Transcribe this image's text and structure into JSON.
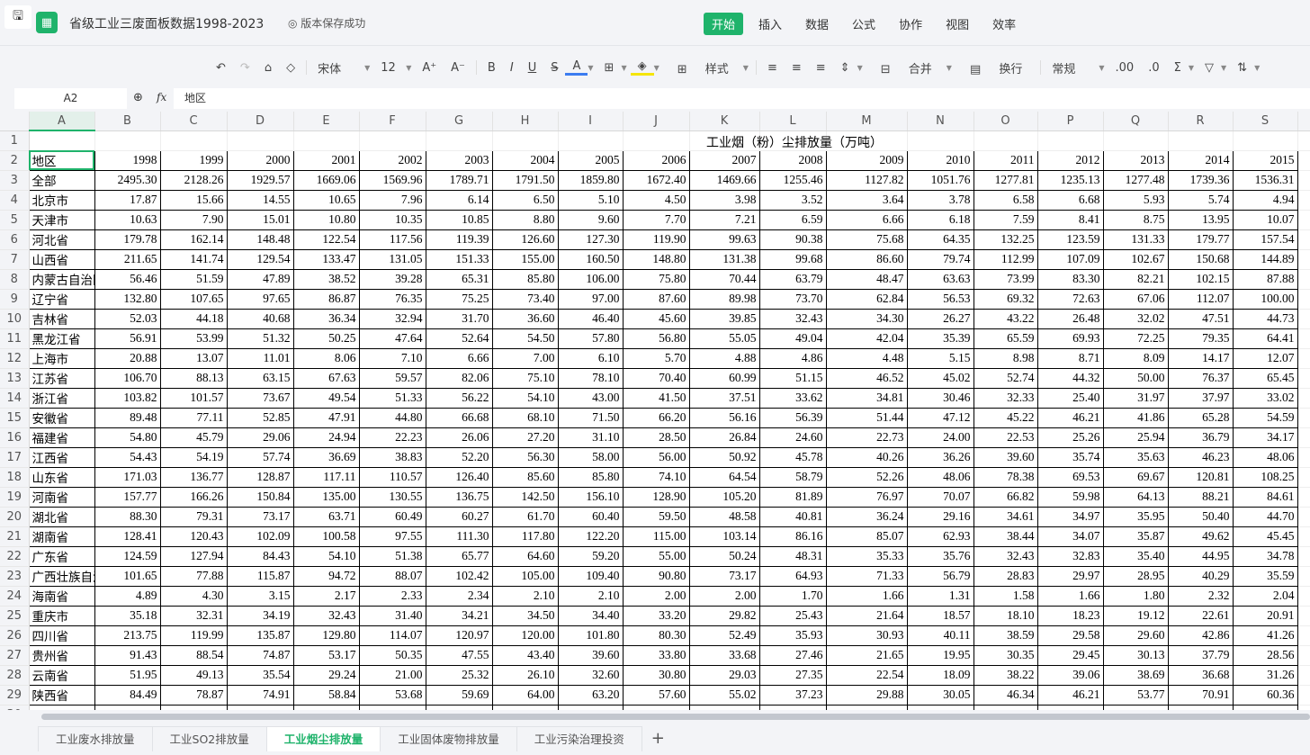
{
  "app": {
    "title": "省级工业三废面板数据1998-2023",
    "save_status": "版本保存成功"
  },
  "menu": [
    "开始",
    "插入",
    "数据",
    "公式",
    "协作",
    "视图",
    "效率"
  ],
  "toolbar": {
    "font": "宋体",
    "font_size": "12",
    "style_label": "样式",
    "merge_label": "合并",
    "wrap_label": "换行",
    "number_format": "常规"
  },
  "formula_bar": {
    "cell_ref": "A2",
    "fx": "fx",
    "value": "地区"
  },
  "columns": [
    "A",
    "B",
    "C",
    "D",
    "E",
    "F",
    "G",
    "H",
    "I",
    "J",
    "K",
    "L",
    "M",
    "N",
    "O",
    "P",
    "Q",
    "R",
    "S"
  ],
  "sheet": {
    "title": "工业烟（粉）尘排放量（万吨）",
    "header": [
      "地区",
      "1998",
      "1999",
      "2000",
      "2001",
      "2002",
      "2003",
      "2004",
      "2005",
      "2006",
      "2007",
      "2008",
      "2009",
      "2010",
      "2011",
      "2012",
      "2013",
      "2014",
      "2015"
    ],
    "rows": [
      [
        "全部",
        "2495.30",
        "2128.26",
        "1929.57",
        "1669.06",
        "1569.96",
        "1789.71",
        "1791.50",
        "1859.80",
        "1672.40",
        "1469.66",
        "1255.46",
        "1127.82",
        "1051.76",
        "1277.81",
        "1235.13",
        "1277.48",
        "1739.36",
        "1536.31"
      ],
      [
        "北京市",
        "17.87",
        "15.66",
        "14.55",
        "10.65",
        "7.96",
        "6.14",
        "6.50",
        "5.10",
        "4.50",
        "3.98",
        "3.52",
        "3.64",
        "3.78",
        "6.58",
        "6.68",
        "5.93",
        "5.74",
        "4.94"
      ],
      [
        "天津市",
        "10.63",
        "7.90",
        "15.01",
        "10.80",
        "10.35",
        "10.85",
        "8.80",
        "9.60",
        "7.70",
        "7.21",
        "6.59",
        "6.66",
        "6.18",
        "7.59",
        "8.41",
        "8.75",
        "13.95",
        "10.07"
      ],
      [
        "河北省",
        "179.78",
        "162.14",
        "148.48",
        "122.54",
        "117.56",
        "119.39",
        "126.60",
        "127.30",
        "119.90",
        "99.63",
        "90.38",
        "75.68",
        "64.35",
        "132.25",
        "123.59",
        "131.33",
        "179.77",
        "157.54"
      ],
      [
        "山西省",
        "211.65",
        "141.74",
        "129.54",
        "133.47",
        "131.05",
        "151.33",
        "155.00",
        "160.50",
        "148.80",
        "131.38",
        "99.68",
        "86.60",
        "79.74",
        "112.99",
        "107.09",
        "102.67",
        "150.68",
        "144.89"
      ],
      [
        "内蒙古自治区",
        "56.46",
        "51.59",
        "47.89",
        "38.52",
        "39.28",
        "65.31",
        "85.80",
        "106.00",
        "75.80",
        "70.44",
        "63.79",
        "48.47",
        "63.63",
        "73.99",
        "83.30",
        "82.21",
        "102.15",
        "87.88"
      ],
      [
        "辽宁省",
        "132.80",
        "107.65",
        "97.65",
        "86.87",
        "76.35",
        "75.25",
        "73.40",
        "97.00",
        "87.60",
        "89.98",
        "73.70",
        "62.84",
        "56.53",
        "69.32",
        "72.63",
        "67.06",
        "112.07",
        "100.00"
      ],
      [
        "吉林省",
        "52.03",
        "44.18",
        "40.68",
        "36.34",
        "32.94",
        "31.70",
        "36.60",
        "46.40",
        "45.60",
        "39.85",
        "32.43",
        "34.30",
        "26.27",
        "43.22",
        "26.48",
        "32.02",
        "47.51",
        "44.73"
      ],
      [
        "黑龙江省",
        "56.91",
        "53.99",
        "51.32",
        "50.25",
        "47.64",
        "52.64",
        "54.50",
        "57.80",
        "56.80",
        "55.05",
        "49.04",
        "42.04",
        "35.39",
        "65.59",
        "69.93",
        "72.25",
        "79.35",
        "64.41"
      ],
      [
        "上海市",
        "20.88",
        "13.07",
        "11.01",
        "8.06",
        "7.10",
        "6.66",
        "7.00",
        "6.10",
        "5.70",
        "4.88",
        "4.86",
        "4.48",
        "5.15",
        "8.98",
        "8.71",
        "8.09",
        "14.17",
        "12.07"
      ],
      [
        "江苏省",
        "106.70",
        "88.13",
        "63.15",
        "67.63",
        "59.57",
        "82.06",
        "75.10",
        "78.10",
        "70.40",
        "60.99",
        "51.15",
        "46.52",
        "45.02",
        "52.74",
        "44.32",
        "50.00",
        "76.37",
        "65.45"
      ],
      [
        "浙江省",
        "103.82",
        "101.57",
        "73.67",
        "49.54",
        "51.33",
        "56.22",
        "54.10",
        "43.00",
        "41.50",
        "37.51",
        "33.62",
        "34.81",
        "30.46",
        "32.33",
        "25.40",
        "31.97",
        "37.97",
        "33.02"
      ],
      [
        "安徽省",
        "89.48",
        "77.11",
        "52.85",
        "47.91",
        "44.80",
        "66.68",
        "68.10",
        "71.50",
        "66.20",
        "56.16",
        "56.39",
        "51.44",
        "47.12",
        "45.22",
        "46.21",
        "41.86",
        "65.28",
        "54.59"
      ],
      [
        "福建省",
        "54.80",
        "45.79",
        "29.06",
        "24.94",
        "22.23",
        "26.06",
        "27.20",
        "31.10",
        "28.50",
        "26.84",
        "24.60",
        "22.73",
        "24.00",
        "22.53",
        "25.26",
        "25.94",
        "36.79",
        "34.17"
      ],
      [
        "江西省",
        "54.43",
        "54.19",
        "57.74",
        "36.69",
        "38.83",
        "52.20",
        "56.30",
        "58.00",
        "56.00",
        "50.92",
        "45.78",
        "40.26",
        "36.26",
        "39.60",
        "35.74",
        "35.63",
        "46.23",
        "48.06"
      ],
      [
        "山东省",
        "171.03",
        "136.77",
        "128.87",
        "117.11",
        "110.57",
        "126.40",
        "85.60",
        "85.80",
        "74.10",
        "64.54",
        "58.79",
        "52.26",
        "48.06",
        "78.38",
        "69.53",
        "69.67",
        "120.81",
        "108.25"
      ],
      [
        "河南省",
        "157.77",
        "166.26",
        "150.84",
        "135.00",
        "130.55",
        "136.75",
        "142.50",
        "156.10",
        "128.90",
        "105.20",
        "81.89",
        "76.97",
        "70.07",
        "66.82",
        "59.98",
        "64.13",
        "88.21",
        "84.61"
      ],
      [
        "湖北省",
        "88.30",
        "79.31",
        "73.17",
        "63.71",
        "60.49",
        "60.27",
        "61.70",
        "60.40",
        "59.50",
        "48.58",
        "40.81",
        "36.24",
        "29.16",
        "34.61",
        "34.97",
        "35.95",
        "50.40",
        "44.70"
      ],
      [
        "湖南省",
        "128.41",
        "120.43",
        "102.09",
        "100.58",
        "97.55",
        "111.30",
        "117.80",
        "122.20",
        "115.00",
        "103.14",
        "86.16",
        "85.07",
        "62.93",
        "38.44",
        "34.07",
        "35.87",
        "49.62",
        "45.45"
      ],
      [
        "广东省",
        "124.59",
        "127.94",
        "84.43",
        "54.10",
        "51.38",
        "65.77",
        "64.60",
        "59.20",
        "55.00",
        "50.24",
        "48.31",
        "35.33",
        "35.76",
        "32.43",
        "32.83",
        "35.40",
        "44.95",
        "34.78"
      ],
      [
        "广西壮族自治区",
        "101.65",
        "77.88",
        "115.87",
        "94.72",
        "88.07",
        "102.42",
        "105.00",
        "109.40",
        "90.80",
        "73.17",
        "64.93",
        "71.33",
        "56.79",
        "28.83",
        "29.97",
        "28.95",
        "40.29",
        "35.59"
      ],
      [
        "海南省",
        "4.89",
        "4.30",
        "3.15",
        "2.17",
        "2.33",
        "2.34",
        "2.10",
        "2.10",
        "2.00",
        "2.00",
        "1.70",
        "1.66",
        "1.31",
        "1.58",
        "1.66",
        "1.80",
        "2.32",
        "2.04"
      ],
      [
        "重庆市",
        "35.18",
        "32.31",
        "34.19",
        "32.43",
        "31.40",
        "34.21",
        "34.50",
        "34.40",
        "33.20",
        "29.82",
        "25.43",
        "21.64",
        "18.57",
        "18.10",
        "18.23",
        "19.12",
        "22.61",
        "20.91"
      ],
      [
        "四川省",
        "213.75",
        "119.99",
        "135.87",
        "129.80",
        "114.07",
        "120.97",
        "120.00",
        "101.80",
        "80.30",
        "52.49",
        "35.93",
        "30.93",
        "40.11",
        "38.59",
        "29.58",
        "29.60",
        "42.86",
        "41.26"
      ],
      [
        "贵州省",
        "91.43",
        "88.54",
        "74.87",
        "53.17",
        "50.35",
        "47.55",
        "43.40",
        "39.60",
        "33.80",
        "33.68",
        "27.46",
        "21.65",
        "19.95",
        "30.35",
        "29.45",
        "30.13",
        "37.79",
        "28.56"
      ],
      [
        "云南省",
        "51.95",
        "49.13",
        "35.54",
        "29.24",
        "21.00",
        "25.32",
        "26.10",
        "32.60",
        "30.80",
        "29.03",
        "27.35",
        "22.54",
        "18.09",
        "38.22",
        "39.06",
        "38.69",
        "36.68",
        "31.26"
      ],
      [
        "陕西省",
        "84.49",
        "78.87",
        "74.91",
        "58.84",
        "53.68",
        "59.69",
        "64.00",
        "63.20",
        "57.60",
        "55.02",
        "37.23",
        "29.88",
        "30.05",
        "46.34",
        "46.21",
        "53.77",
        "70.91",
        "60.36"
      ]
    ]
  },
  "sheet_tabs": [
    {
      "label": "工业废水排放量"
    },
    {
      "label": "工业SO2排放量"
    },
    {
      "label": "工业烟尘排放量",
      "active": true
    },
    {
      "label": "工业固体废物排放量"
    },
    {
      "label": "工业污染治理投资"
    }
  ],
  "colors": {
    "accent": "#1fb36b"
  }
}
